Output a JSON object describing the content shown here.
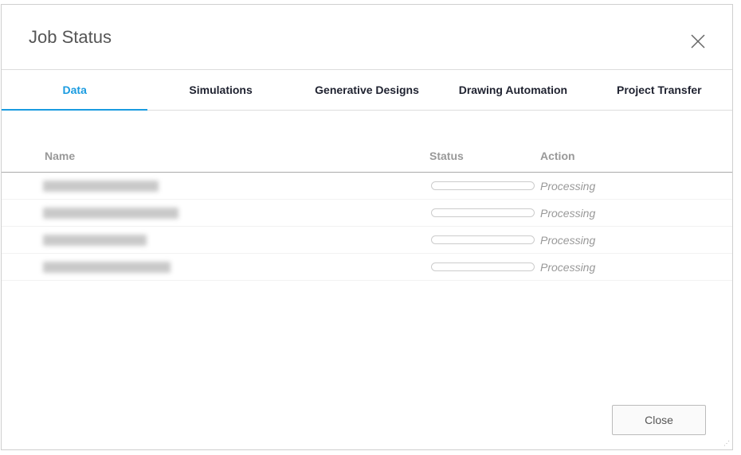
{
  "dialog": {
    "title": "Job Status",
    "close_label": "Close"
  },
  "tabs": [
    {
      "label": "Data",
      "active": true
    },
    {
      "label": "Simulations"
    },
    {
      "label": "Generative Designs"
    },
    {
      "label": "Drawing Automation"
    },
    {
      "label": "Project Transfer"
    }
  ],
  "table": {
    "headers": {
      "name": "Name",
      "status": "Status",
      "action": "Action"
    },
    "rows": [
      {
        "progress_percent": 0,
        "action": "Processing"
      },
      {
        "progress_percent": 0,
        "action": "Processing"
      },
      {
        "progress_percent": 0,
        "action": "Processing"
      },
      {
        "progress_percent": 0,
        "action": "Processing"
      }
    ]
  },
  "colors": {
    "accent": "#1a9be0"
  }
}
